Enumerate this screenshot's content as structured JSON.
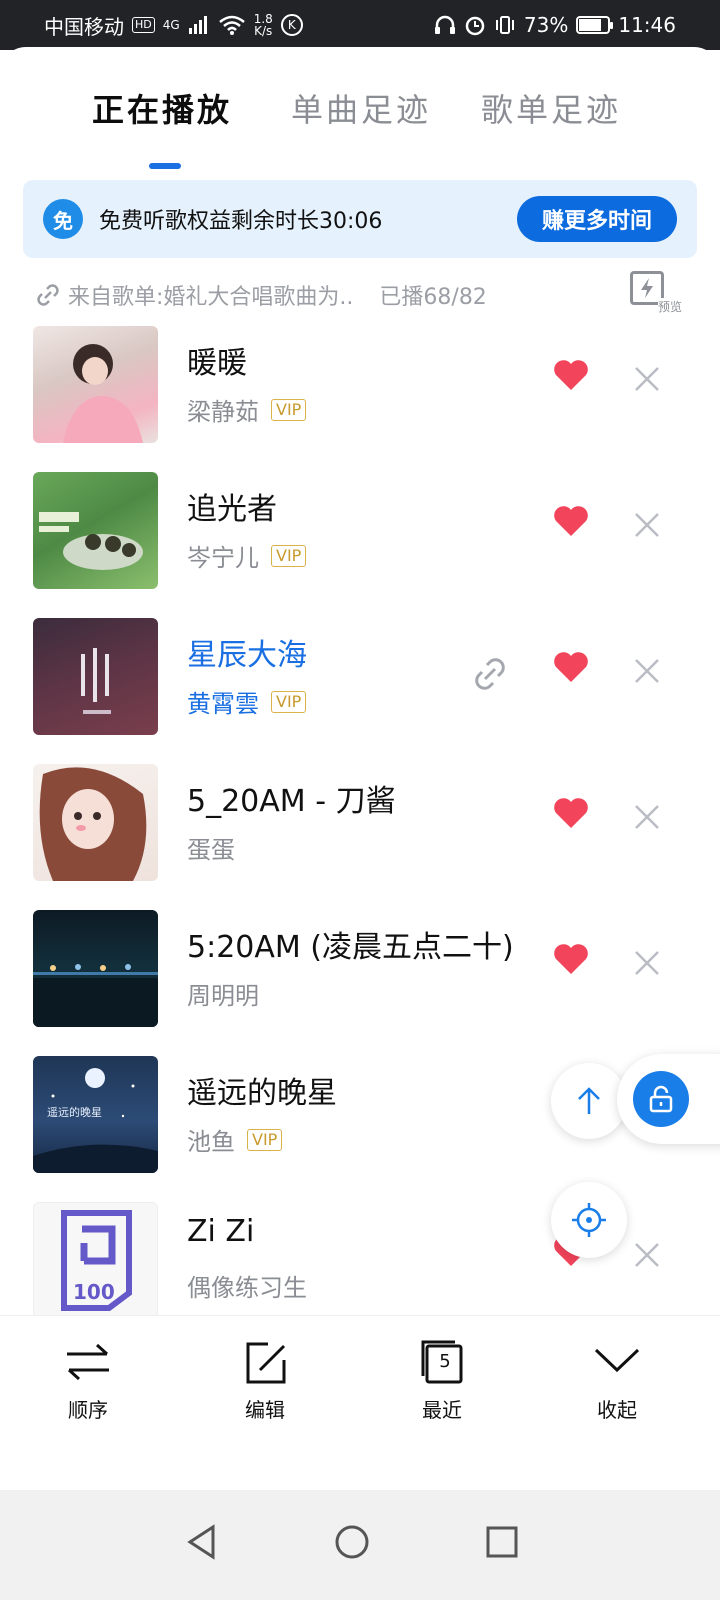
{
  "status_bar": {
    "carrier": "中国移动",
    "hd": "HD",
    "net": "4G",
    "speed_top": "1.8",
    "speed_bottom": "K/s",
    "k_icon": "K",
    "battery": "73%",
    "time": "11:46"
  },
  "tabs": [
    {
      "label": "正在播放",
      "active": true
    },
    {
      "label": "单曲足迹",
      "active": false
    },
    {
      "label": "歌单足迹",
      "active": false
    }
  ],
  "banner": {
    "icon_text": "免",
    "text": "免费听歌权益剩余时长30:06",
    "button": "赚更多时间"
  },
  "source": {
    "text": "来自歌单:婚礼大合唱歌曲为..",
    "played": "已播68/82",
    "preview_label": "预览"
  },
  "songs": [
    {
      "title": "暖暖",
      "artist": "梁静茹",
      "vip": "VIP",
      "liked": true
    },
    {
      "title": "追光者",
      "artist": "岑宁儿",
      "vip": "VIP",
      "liked": true
    },
    {
      "title": "星辰大海",
      "artist": "黄霄雲",
      "vip": "VIP",
      "liked": true,
      "playing": true
    },
    {
      "title": "5_20AM - 刀酱",
      "artist": "蛋蛋",
      "vip": "",
      "liked": true
    },
    {
      "title": "5:20AM (凌晨五点二十)",
      "artist": "周明明",
      "vip": "",
      "liked": true
    },
    {
      "title": "遥远的晚星",
      "artist": "池鱼",
      "vip": "VIP",
      "liked": false
    },
    {
      "title": "Zi Zi",
      "artist": "偶像练习生",
      "vip": "",
      "liked": true
    }
  ],
  "covers": {
    "c6_text": "遥远的晚星",
    "c7_text": "100"
  },
  "actions": [
    {
      "label": "顺序",
      "icon": "shuffle-order-icon"
    },
    {
      "label": "编辑",
      "icon": "edit-icon"
    },
    {
      "label": "最近",
      "icon": "recent-icon",
      "badge": "5"
    },
    {
      "label": "收起",
      "icon": "collapse-icon"
    }
  ],
  "colors": {
    "accent": "#1a6fe3",
    "heart": "#f2445b",
    "vip": "#d8b24a",
    "banner_bg": "#e5f1fc"
  }
}
